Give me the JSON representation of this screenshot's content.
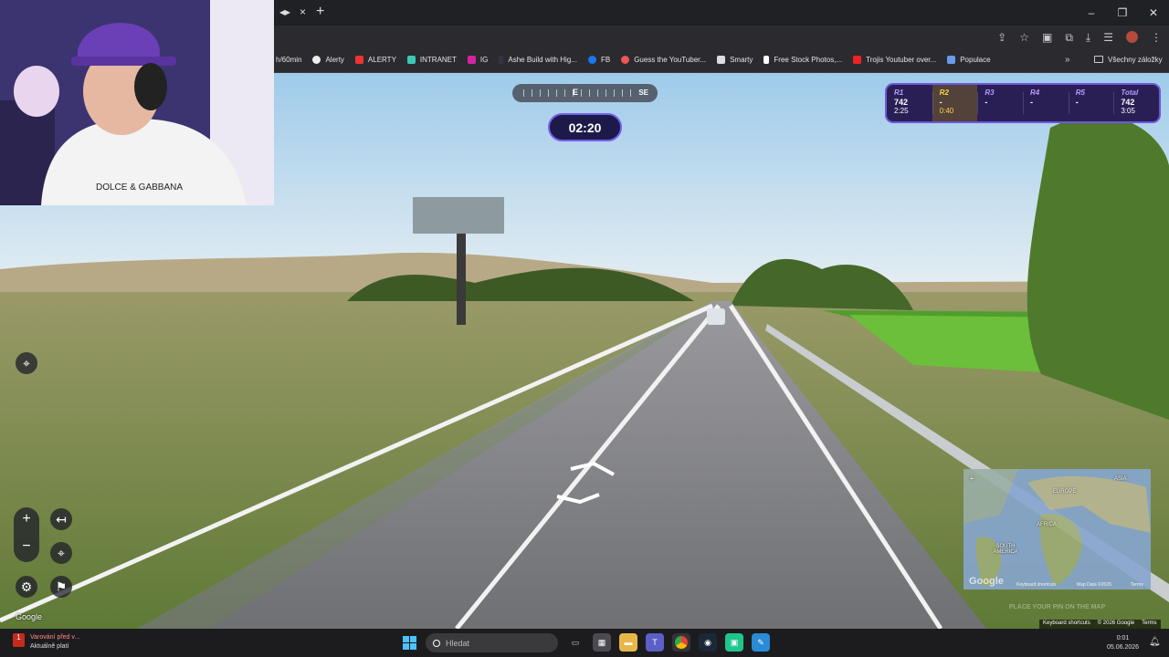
{
  "browser": {
    "tab_actions": [
      "◂▸",
      "×"
    ],
    "new_tab": "+",
    "window_controls": [
      "–",
      "❐",
      "✕"
    ],
    "toolbar_icons": [
      "install-icon",
      "star-icon",
      "extension-icon",
      "puzzle-icon",
      "download-icon",
      "reading-list-icon",
      "profile-icon",
      "menu-icon"
    ]
  },
  "bookmarks": {
    "items": [
      {
        "label": "h/60min"
      },
      {
        "label": "Alerty"
      },
      {
        "label": "ALERTY"
      },
      {
        "label": "INTRANET"
      },
      {
        "label": "IG"
      },
      {
        "label": "Ashe Build with Hig..."
      },
      {
        "label": "FB"
      },
      {
        "label": "Guess the YouTuber..."
      },
      {
        "label": "Smarty"
      },
      {
        "label": "Free Stock Photos,..."
      },
      {
        "label": "Trojis Youtuber over..."
      },
      {
        "label": "Populace"
      }
    ],
    "more": "»",
    "all_bookmarks": "Všechny záložky"
  },
  "webcam": {
    "shirt_text": "DOLCE & GABBANA"
  },
  "hud": {
    "compass": {
      "center": "E",
      "right": "SE"
    },
    "timer": "02:20",
    "rounds": [
      {
        "label": "R1",
        "score": "742",
        "time": "2:25",
        "active": false
      },
      {
        "label": "R2",
        "score": "-",
        "time": "0:40",
        "active": true
      },
      {
        "label": "R3",
        "score": "-",
        "time": "",
        "active": false
      },
      {
        "label": "R4",
        "score": "-",
        "time": "",
        "active": false
      },
      {
        "label": "R5",
        "score": "-",
        "time": "",
        "active": false
      },
      {
        "label": "Total",
        "score": "742",
        "time": "3:05",
        "active": false
      }
    ]
  },
  "controls": {
    "zoom_in": "+",
    "zoom_out": "−",
    "back": "↤",
    "google_logo": "Google"
  },
  "minimap": {
    "labels": [
      "EUROPE",
      "ASIA",
      "AFRICA",
      "SOUTH AMERICA"
    ],
    "google_logo": "Google",
    "keyboard_shortcuts": "Keyboard shortcuts",
    "map_data": "Map Data ©2026",
    "terms": "Terms",
    "pin_button": "PLACE YOUR PIN ON THE MAP"
  },
  "attribution": {
    "keyboard_shortcuts": "Keyboard shortcuts",
    "copyright": "© 2026 Google",
    "terms": "Terms"
  },
  "taskbar": {
    "weather_alert": "Varování před v...",
    "weather_status": "Aktuálně platí",
    "weather_count": "1",
    "search_placeholder": "Hledat",
    "time": "0:01",
    "date": "05.06.2026"
  }
}
